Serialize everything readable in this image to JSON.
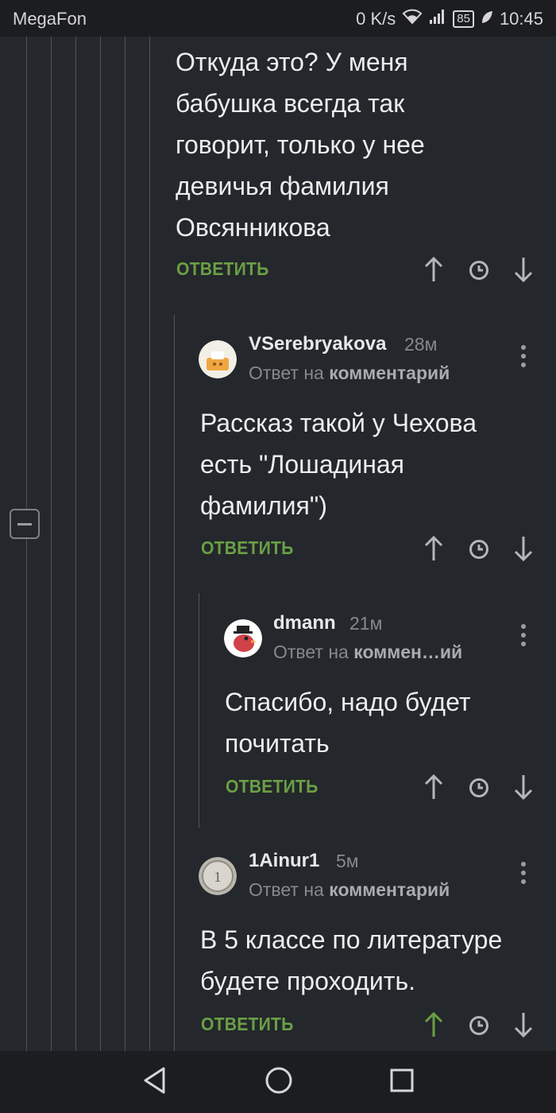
{
  "status_bar": {
    "carrier": "MegaFon",
    "network_speed": "0 K/s",
    "battery_level": "85",
    "time": "10:45"
  },
  "colors": {
    "background": "#24272b",
    "reply_green": "#6a9f46",
    "upvoted_green": "#6a9f46",
    "muted_text": "#85898e"
  },
  "comments": [
    {
      "text": "Откуда это? У меня бабушка всегда так говорит, только у нее девичья фамилия Овсянникова",
      "text_lines": [
        "Откуда это? У меня",
        "бабушка всегда так",
        "говорит, только у нее",
        "девичья фамилия",
        "Овсянникова"
      ],
      "reply_label": "ОТВЕТИТЬ"
    },
    {
      "author": "VSerebryakova",
      "time": "28м",
      "reply_prefix": "Ответ на",
      "reply_target": "комментарий",
      "text_lines": [
        "Рассказ такой у Чехова",
        "есть \"Лошадиная",
        "фамилия\")"
      ],
      "reply_label": "ОТВЕТИТЬ"
    },
    {
      "author": "dmann",
      "time": "21м",
      "reply_prefix": "Ответ на",
      "reply_target": "коммен…ий",
      "text_lines": [
        "Спасибо, надо будет",
        "почитать"
      ],
      "reply_label": "ОТВЕТИТЬ"
    },
    {
      "author": "1Ainur1",
      "time": "5м",
      "reply_prefix": "Ответ на",
      "reply_target": "комментарий",
      "text_lines": [
        "В 5 классе по литературе",
        "будете проходить."
      ],
      "reply_label": "ОТВЕТИТЬ",
      "upvoted": true
    }
  ],
  "icons": {
    "upvote": "arrow-up-icon",
    "save": "clock-icon",
    "downvote": "arrow-down-icon",
    "menu": "more-vertical-icon",
    "collapse": "minus-square-icon",
    "nav_back": "triangle-back-icon",
    "nav_home": "circle-home-icon",
    "nav_recent": "square-recent-icon"
  }
}
